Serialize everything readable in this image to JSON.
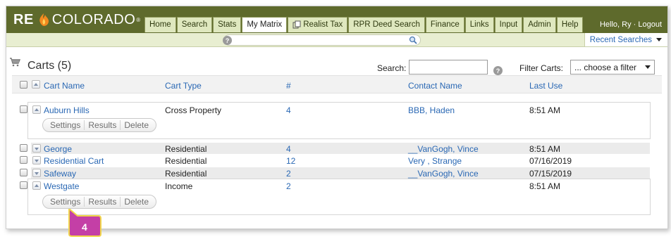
{
  "header": {
    "logo_re": "RE",
    "logo_colorado": "COLORADO",
    "logo_reg": "®",
    "nav": [
      {
        "label": "Home",
        "active": false
      },
      {
        "label": "Search",
        "active": false
      },
      {
        "label": "Stats",
        "active": false
      },
      {
        "label": "My Matrix",
        "active": true
      },
      {
        "label": "Realist Tax",
        "active": false,
        "icon": "copy-icon"
      },
      {
        "label": "RPR Deed Search",
        "active": false
      },
      {
        "label": "Finance",
        "active": false
      },
      {
        "label": "Links",
        "active": false
      },
      {
        "label": "Input",
        "active": false
      },
      {
        "label": "Admin",
        "active": false
      },
      {
        "label": "Help",
        "active": false
      }
    ],
    "greeting": "Hello, Ry · Logout"
  },
  "strip": {
    "recent_searches": "Recent Searches"
  },
  "toolbar": {
    "title": "Carts (5)",
    "search_label": "Search:",
    "search_value": "",
    "filter_label": "Filter Carts:",
    "filter_value": "... choose a filter"
  },
  "table": {
    "columns": [
      "Cart Name",
      "Cart Type",
      "#",
      "Contact Name",
      "Last Use"
    ],
    "rows": [
      {
        "name": "Auburn Hills",
        "type": "Cross Property",
        "count": "4",
        "contact": "BBB, Haden",
        "last_use": "8:51 AM",
        "expanded": true
      },
      {
        "name": "George",
        "type": "Residential",
        "count": "4",
        "contact": "__VanGogh, Vince",
        "last_use": "8:51 AM",
        "expanded": false
      },
      {
        "name": "Residential Cart",
        "type": "Residential",
        "count": "12",
        "contact": "Very , Strange",
        "last_use": "07/16/2019",
        "expanded": false
      },
      {
        "name": "Safeway",
        "type": "Residential",
        "count": "2",
        "contact": "__VanGogh, Vince",
        "last_use": "07/15/2019",
        "expanded": false
      },
      {
        "name": "Westgate",
        "type": "Income",
        "count": "2",
        "contact": "",
        "last_use": "8:51 AM",
        "expanded": true
      }
    ],
    "actions": [
      "Settings",
      "Results",
      "Delete"
    ]
  },
  "callout": {
    "number": "4",
    "color": "#c43fa6"
  },
  "colors": {
    "header_bg": "#5e6a2c",
    "tab_bg": "#dfe8bf",
    "link": "#2a68b4",
    "strip_bg": "#e8eed1"
  }
}
